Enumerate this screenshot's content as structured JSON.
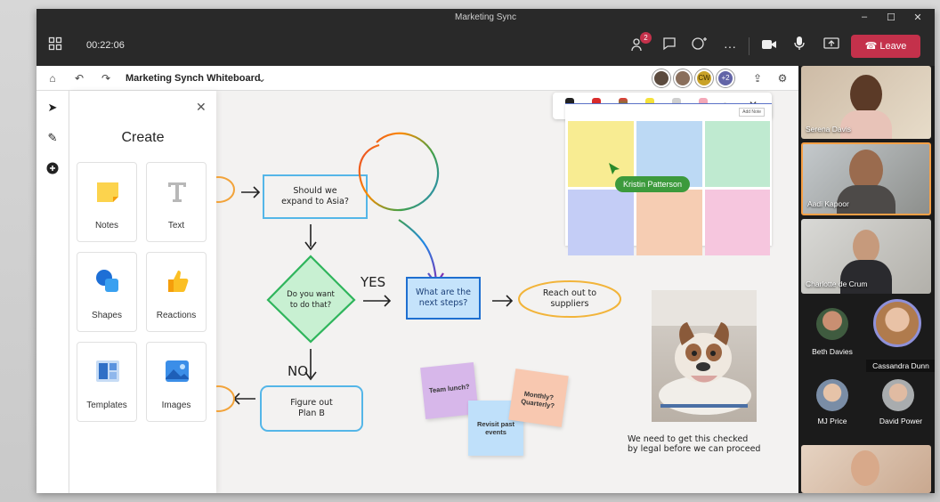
{
  "window": {
    "title": "Marketing Sync",
    "controls": [
      "–",
      "☐",
      "✕"
    ]
  },
  "meeting": {
    "timer": "00:22:06",
    "participants_badge": "2",
    "leave_label": "Leave"
  },
  "whiteboard": {
    "title": "Marketing Synch Whiteboard",
    "extra_count": "+2",
    "avatar_initials": "CW"
  },
  "create_panel": {
    "heading": "Create",
    "tiles": [
      {
        "label": "Notes",
        "icon": "note-icon"
      },
      {
        "label": "Text",
        "icon": "text-icon"
      },
      {
        "label": "Shapes",
        "icon": "shapes-icon"
      },
      {
        "label": "Reactions",
        "icon": "thumbs-up-icon"
      },
      {
        "label": "Templates",
        "icon": "templates-icon"
      },
      {
        "label": "Images",
        "icon": "image-icon"
      }
    ]
  },
  "canvas": {
    "q1": [
      "Should we",
      "expand to Asia?"
    ],
    "q2": [
      "Do you want",
      "to do that?"
    ],
    "yes": "YES",
    "no": "NO",
    "next": [
      "What are the",
      "next steps?"
    ],
    "reach": [
      "Reach out to",
      "suppliers"
    ],
    "planb": [
      "Figure out",
      "Plan B"
    ],
    "cursor_name": "Kristin Patterson",
    "add_note": "Add Note",
    "sticky1": "Team lunch?",
    "sticky2": "Revisit past events",
    "sticky3": "Monthly? Quarterly?",
    "caption": [
      "We need to get this checked",
      "by legal before we can proceed"
    ]
  },
  "participants": {
    "video": [
      "Serena Davis",
      "Aadi Kapoor",
      "Charlotte de Crum"
    ],
    "avatars": [
      "Beth Davies",
      "Cassandra Dunn",
      "MJ Price",
      "David Power"
    ]
  },
  "colors": {
    "leave": "#c4314b",
    "accent": "#6264a7",
    "active_tile": "#f7a046"
  }
}
